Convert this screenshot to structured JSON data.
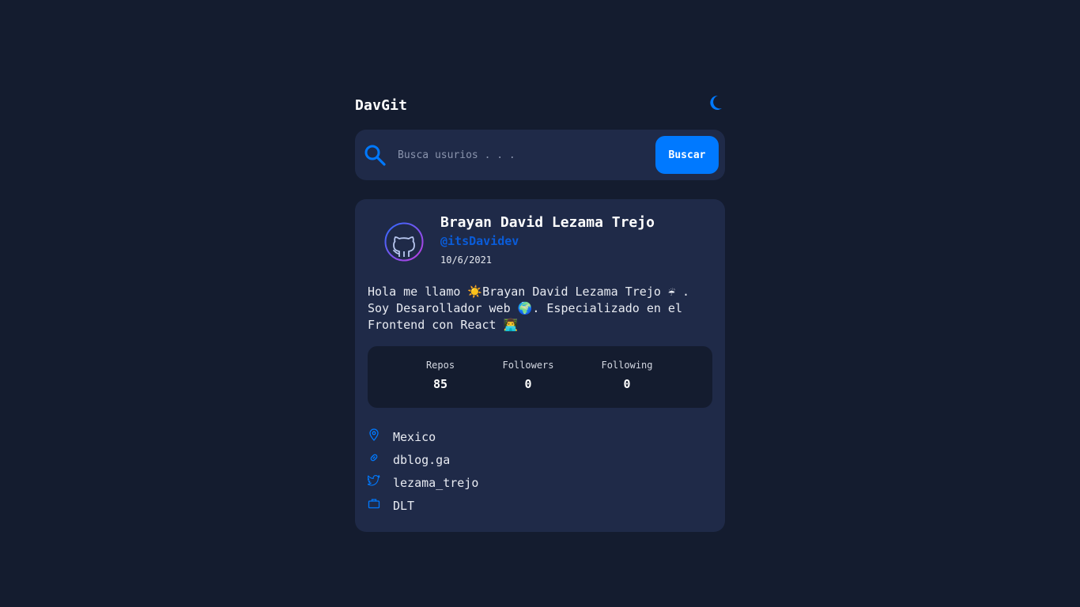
{
  "header": {
    "brand": "DavGit",
    "theme_icon": "moon-icon"
  },
  "search": {
    "placeholder": "Busca usurios . . .",
    "value": "",
    "button_label": "Buscar",
    "icon": "search-icon"
  },
  "profile": {
    "name": "Brayan David Lezama Trejo",
    "handle": "@itsDavidev",
    "joined": "10/6/2021",
    "bio": "Hola me llamo ☀️Brayan David Lezama Trejo ☔ .\nSoy Desarollador web 🌍. Especializado en el\nFrontend con React 👨‍💻",
    "avatar_icon": "github-octocat-icon",
    "stats": [
      {
        "label": "Repos",
        "value": "85"
      },
      {
        "label": "Followers",
        "value": "0"
      },
      {
        "label": "Following",
        "value": "0"
      }
    ],
    "links": [
      {
        "icon": "location-pin-icon",
        "text": "Mexico"
      },
      {
        "icon": "link-icon",
        "text": "dblog.ga"
      },
      {
        "icon": "twitter-icon",
        "text": "lezama_trejo"
      },
      {
        "icon": "briefcase-icon",
        "text": "DLT"
      }
    ]
  },
  "colors": {
    "background": "#141c2f",
    "card": "#1f2a48",
    "accent": "#0079ff",
    "handle": "#0a5cd9"
  }
}
